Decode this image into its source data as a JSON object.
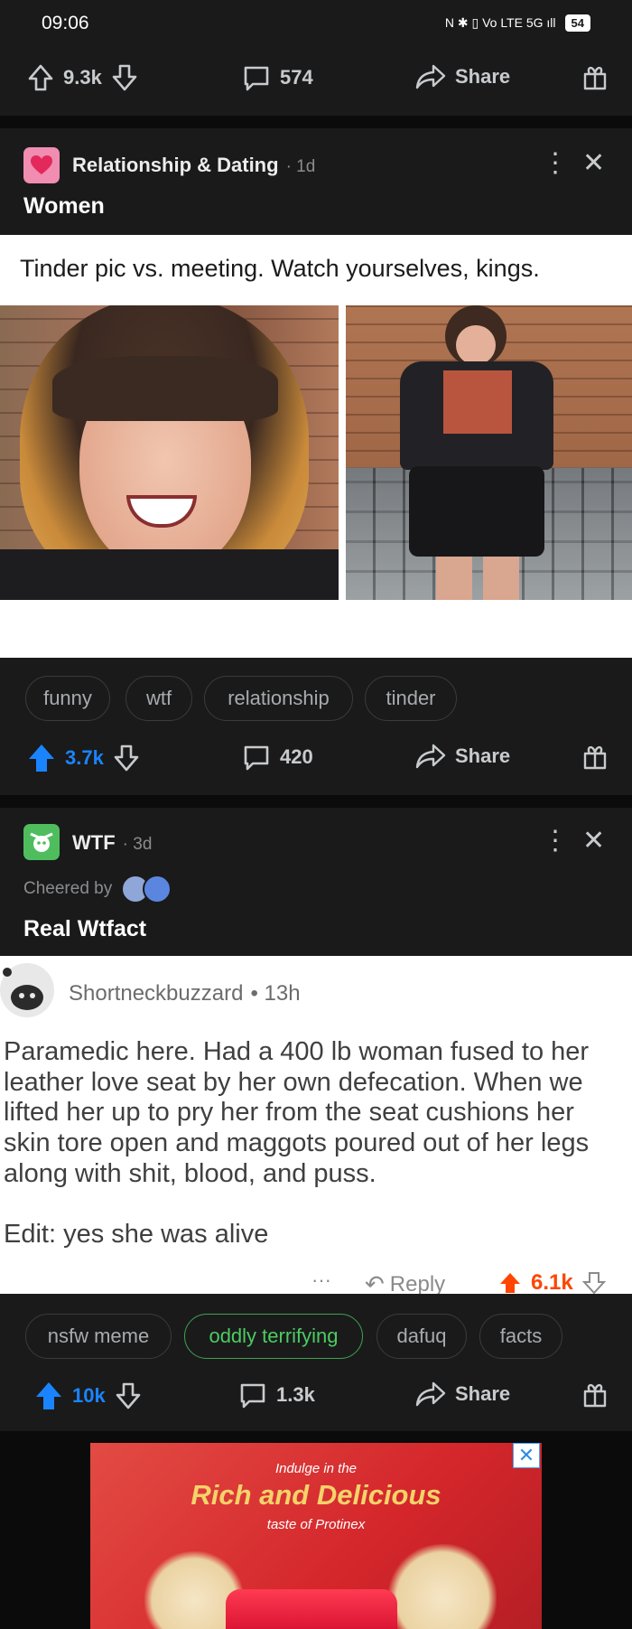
{
  "status": {
    "time": "09:06",
    "icons": "N ✱ ▯ Vo LTE 5G ıll",
    "battery": "54"
  },
  "top_actions": {
    "upvotes": "9.3k",
    "comments": "574",
    "share": "Share"
  },
  "post1": {
    "subreddit": "Relationship & Dating",
    "age": "· 1d",
    "title": "Women",
    "image_caption": "Tinder pic vs. meeting. Watch yourselves, kings.",
    "chips": [
      "funny",
      "wtf",
      "relationship",
      "tinder"
    ],
    "upvotes": "3.7k",
    "comments": "420",
    "share": "Share"
  },
  "post2": {
    "subreddit": "WTF",
    "age": "· 3d",
    "cheered_by": "Cheered by",
    "title": "Real Wtfact",
    "comment_user": "Shortneckbuzzard",
    "comment_age": "• 13h",
    "comment_text": "Paramedic here. Had a 400 lb woman fused to her leather love seat by her own defecation. When we lifted her up to pry her from the seat cushions her skin tore open and maggots poured out of her legs along with shit, blood, and puss.",
    "comment_edit": "Edit: yes she was alive",
    "comment_dots": "···",
    "comment_reply": "Reply",
    "comment_votes": "6.1k",
    "chips": [
      "nsfw meme",
      "oddly terrifying",
      "dafuq",
      "facts"
    ],
    "upvotes": "10k",
    "comments": "1.3k",
    "share": "Share"
  },
  "ad": {
    "line1": "Indulge in the",
    "line2": "Rich and Delicious",
    "line3": "taste of Protinex"
  },
  "colors": {
    "background": "#1a1a1b",
    "upvote_blue": "#1a84ff",
    "chip_green": "#4ccb61",
    "orange": "#ff4500"
  }
}
